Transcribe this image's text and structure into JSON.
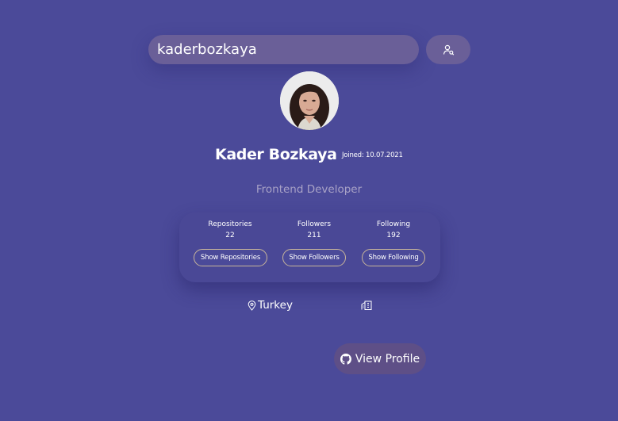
{
  "search": {
    "value": "kaderbozkaya",
    "button_icon": "user-search-icon"
  },
  "profile": {
    "name": "Kader Bozkaya",
    "joined": "Joined: 10.07.2021",
    "bio": "Frontend Developer",
    "avatar_icon": "avatar-photo"
  },
  "stats": {
    "repositories": {
      "label": "Repositories",
      "value": "22",
      "button": "Show Repositories"
    },
    "followers": {
      "label": "Followers",
      "value": "211",
      "button": "Show Followers"
    },
    "following": {
      "label": "Following",
      "value": "192",
      "button": "Show Following"
    }
  },
  "location": {
    "text": "Turkey",
    "icon": "map-pin-icon",
    "company_icon": "building-icon"
  },
  "view_profile": {
    "label": "View Profile",
    "icon": "github-icon"
  },
  "colors": {
    "background": "#4b4a99",
    "input": "#6a5f98",
    "button_border": "#c8b59a",
    "view_profile_bg": "#5e4f87",
    "bio_text": "#a8a2c6"
  }
}
